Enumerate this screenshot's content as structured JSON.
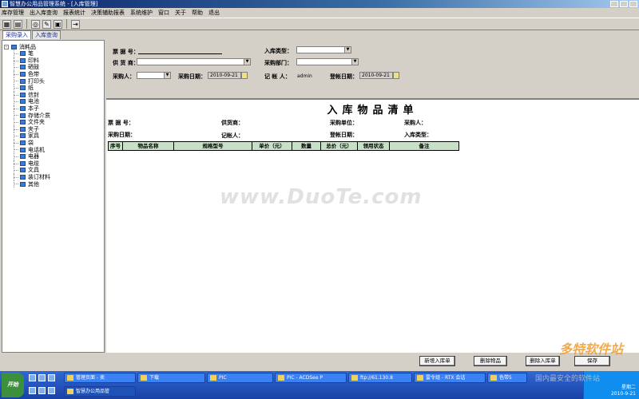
{
  "window": {
    "title": "智慧办公用品管理系统 - [入库管理]"
  },
  "menu": [
    "库存管理",
    "出入库查询",
    "报表统计",
    "决策辅助报表",
    "系统维护",
    "窗口",
    "关于",
    "帮助",
    "退出"
  ],
  "tabs": [
    "采购录入",
    "入库查询"
  ],
  "tree": {
    "root": "消耗品",
    "items": [
      "笔",
      "印料",
      "硒鼓",
      "色带",
      "打印头",
      "纸",
      "信封",
      "电池",
      "本子",
      "存储介质",
      "文件夹",
      "夹子",
      "家具",
      "袋",
      "电话机",
      "电器",
      "电缆",
      "文具",
      "装订材料",
      "其他"
    ]
  },
  "form": {
    "ticket_no_label": "票 据 号：",
    "entry_type_label": "入库类型：",
    "supplier_label": "供 货 商：",
    "purchase_dept_label": "采购部门：",
    "buyer_label": "采购人：",
    "purchase_date_label": "采购日期：",
    "purchase_date_value": "2010-09-21",
    "recorder_label": "记 帐 人：",
    "recorder_value": "admin",
    "post_date_label": "登帐日期：",
    "post_date_value": "2010-09-21"
  },
  "document": {
    "title": "入库物品清单",
    "ticket_no_label": "票 据 号：",
    "supplier_label": "供货商：",
    "purchase_unit_label": "采购单位：",
    "buyer_label": "采购人：",
    "purchase_date_label": "采购日期：",
    "recorder_label": "记帐人：",
    "post_date_label": "登帐日期：",
    "entry_type_label": "入库类型：",
    "columns": [
      "序号",
      "物品名称",
      "规格型号",
      "单价（元）",
      "数量",
      "总价（元）",
      "领用状态",
      "备注"
    ]
  },
  "watermark": "www.DuoTe.com",
  "buttons": {
    "new_entry": "新增入库单",
    "delete_item": "删除物品",
    "delete_entry": "删除入库单",
    "save": "保存"
  },
  "taskbar": {
    "start": "开始",
    "tasks": [
      "管理页面 - 卖",
      "下载",
      "PIC",
      "PIC - ACDSee P",
      "ftp://61.130.8",
      "雷令组 - RTX 会话",
      "色带5",
      "智慧办公用品管"
    ],
    "clock_day": "星期二",
    "clock_date": "2010-9-21"
  },
  "brand": {
    "logo": "多特软件站",
    "tagline": "国内最安全的软件站"
  }
}
